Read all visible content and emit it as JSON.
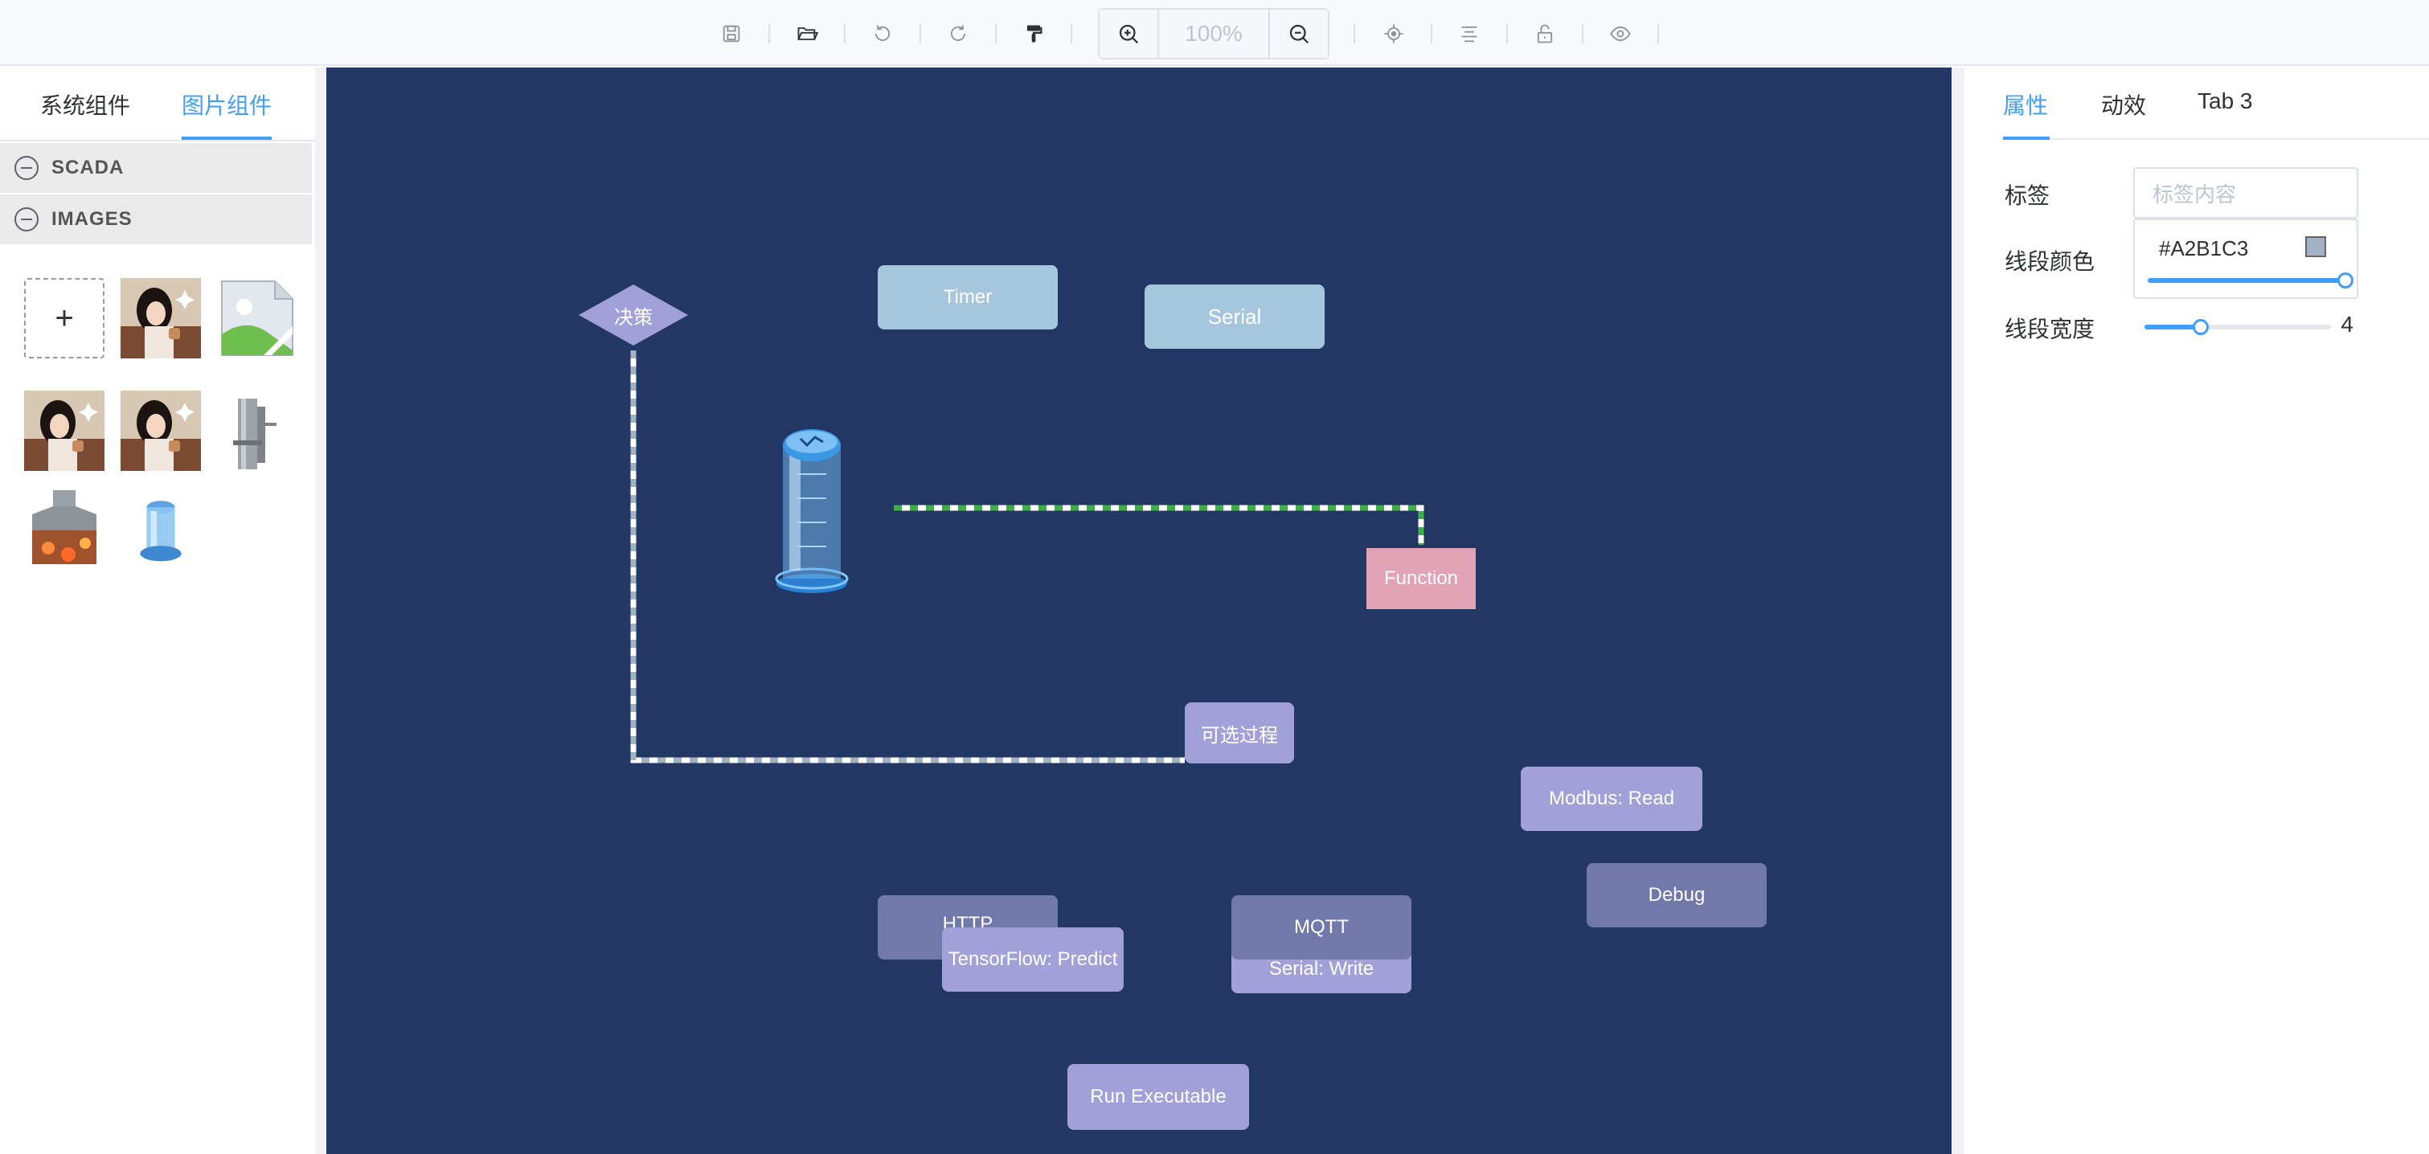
{
  "toolbar": {
    "icons": [
      "save-icon",
      "folder-open-icon",
      "undo-icon",
      "redo-icon",
      "format-painter-icon",
      "zoom-in-icon",
      "zoom-out-icon",
      "locate-icon",
      "align-icon",
      "unlock-icon",
      "preview-eye-icon"
    ],
    "zoom_value": "100%"
  },
  "left_panel": {
    "tabs": [
      "系统组件",
      "图片组件"
    ],
    "active_tab": "图片组件",
    "sections": [
      {
        "label": "SCADA"
      },
      {
        "label": "IMAGES"
      }
    ],
    "add_label": "+",
    "thumbnails": [
      "girl-photo",
      "broken-image",
      "girl-photo",
      "girl-photo",
      "pipe-valve",
      "furnace",
      "water-tank"
    ]
  },
  "canvas": {
    "background": "#233765",
    "nodes": [
      {
        "id": "decision",
        "label": "决策",
        "shape": "diamond",
        "color": "#A2A0D8"
      },
      {
        "id": "timer",
        "label": "Timer",
        "color": "#A5C6DC"
      },
      {
        "id": "serial",
        "label": "Serial",
        "color": "#A5C6DC"
      },
      {
        "id": "function",
        "label": "Function",
        "color": "#E3A3B7"
      },
      {
        "id": "optional",
        "label": "可选过程",
        "color": "#A2A0D8"
      },
      {
        "id": "modbus",
        "label": "Modbus: Read",
        "color": "#A2A0D8"
      },
      {
        "id": "debug",
        "label": "Debug",
        "color": "#7079AA"
      },
      {
        "id": "http",
        "label": "HTTP",
        "color": "#7079AA"
      },
      {
        "id": "tensorflow",
        "label": "TensorFlow: Predict",
        "color": "#A2A0D8"
      },
      {
        "id": "mqtt",
        "label": "MQTT",
        "color": "#7079AA"
      },
      {
        "id": "serialwrite",
        "label": "Serial: Write",
        "color": "#A2A0D8"
      },
      {
        "id": "runexec",
        "label": "Run Executable",
        "color": "#A2A0D8"
      }
    ]
  },
  "right_panel": {
    "tabs": [
      "属性",
      "动效",
      "Tab 3"
    ],
    "active_tab": "属性",
    "label_field": {
      "label": "标签",
      "placeholder": "标签内容"
    },
    "line_color": {
      "label": "线段颜色",
      "value": "#A2B1C3",
      "swatch": "#A2B1C3"
    },
    "line_width": {
      "label": "线段宽度",
      "value": "4",
      "fraction": 0.3
    }
  }
}
